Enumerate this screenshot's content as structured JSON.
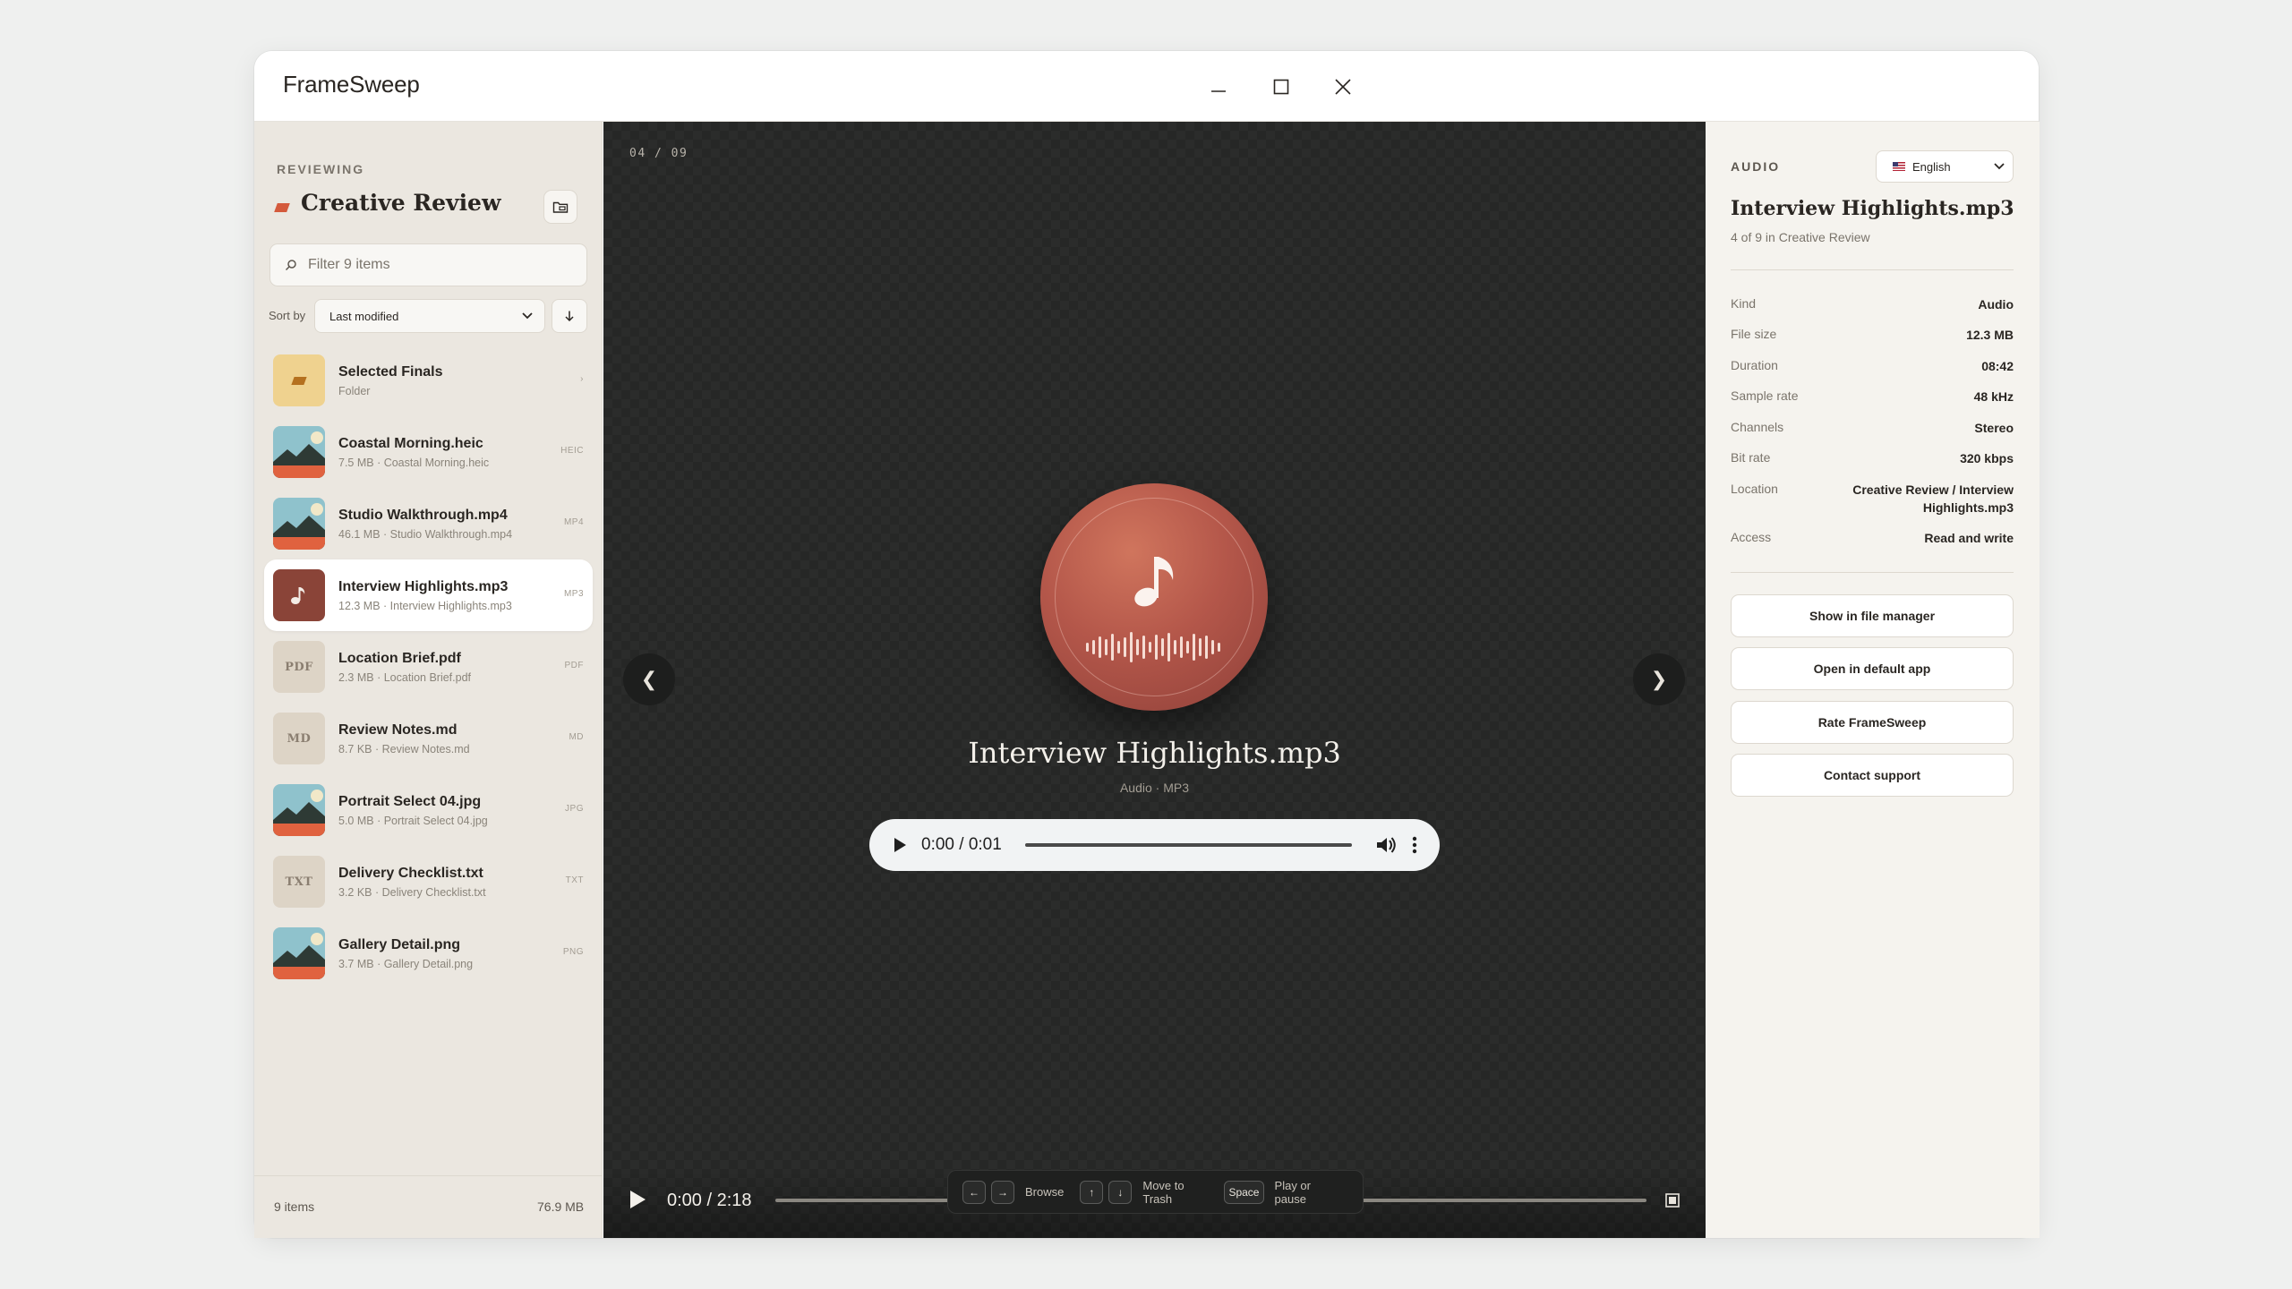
{
  "app": {
    "title": "FrameSweep"
  },
  "sidebar": {
    "eyebrow": "REVIEWING",
    "title": "Creative Review",
    "filter_placeholder": "Filter 9 items",
    "sort_label": "Sort by",
    "sort_value": "Last modified",
    "files": [
      {
        "name": "Selected Finals",
        "meta": "Folder",
        "ext": "›",
        "kind": "folder"
      },
      {
        "name": "Coastal Morning.heic",
        "meta": "7.5 MB · Coastal Morning.heic",
        "ext": "HEIC",
        "kind": "image"
      },
      {
        "name": "Studio Walkthrough.mp4",
        "meta": "46.1 MB · Studio Walkthrough.mp4",
        "ext": "MP4",
        "kind": "image"
      },
      {
        "name": "Interview Highlights.mp3",
        "meta": "12.3 MB · Interview Highlights.mp3",
        "ext": "MP3",
        "kind": "audio"
      },
      {
        "name": "Location Brief.pdf",
        "meta": "2.3 MB · Location Brief.pdf",
        "ext": "PDF",
        "kind": "doc",
        "badge": "PDF"
      },
      {
        "name": "Review Notes.md",
        "meta": "8.7 KB · Review Notes.md",
        "ext": "MD",
        "kind": "doc",
        "badge": "MD"
      },
      {
        "name": "Portrait Select 04.jpg",
        "meta": "5.0 MB · Portrait Select 04.jpg",
        "ext": "JPG",
        "kind": "image"
      },
      {
        "name": "Delivery Checklist.txt",
        "meta": "3.2 KB · Delivery Checklist.txt",
        "ext": "TXT",
        "kind": "doc",
        "badge": "TXT"
      },
      {
        "name": "Gallery Detail.png",
        "meta": "3.7 MB · Gallery Detail.png",
        "ext": "PNG",
        "kind": "image"
      }
    ],
    "footer_count": "9 items",
    "footer_size": "76.9 MB"
  },
  "stage": {
    "counter": "04 / 09",
    "title": "Interview Highlights.mp3",
    "subtitle": "Audio · MP3",
    "player_time": "0:00 / 0:01",
    "player_progress": 0,
    "bottom_time": "0:00 / 2:18",
    "bottom_progress": 0,
    "hints": {
      "browse": "Browse",
      "trash": "Move to Trash",
      "space_key": "Space",
      "play": "Play or pause"
    }
  },
  "panel": {
    "eyebrow": "AUDIO",
    "language": "English",
    "title": "Interview Highlights.mp3",
    "subtitle": "4 of 9 in Creative Review",
    "meta": [
      {
        "key": "Kind",
        "value": "Audio"
      },
      {
        "key": "File size",
        "value": "12.3 MB"
      },
      {
        "key": "Duration",
        "value": "08:42"
      },
      {
        "key": "Sample rate",
        "value": "48 kHz"
      },
      {
        "key": "Channels",
        "value": "Stereo"
      },
      {
        "key": "Bit rate",
        "value": "320 kbps"
      },
      {
        "key": "Location",
        "value": "Creative Review / Interview Highlights.mp3"
      },
      {
        "key": "Access",
        "value": "Read and write"
      }
    ],
    "buttons": {
      "show_in_file_manager": "Show in file manager",
      "open_default": "Open in default app",
      "rate": "Rate FrameSweep",
      "contact": "Contact support"
    }
  },
  "colors": {
    "accent": "#d45a3c",
    "stage_bg": "#262726",
    "panel_bg": "#f5f3ee",
    "sidebar_bg": "#ebe7e0"
  }
}
